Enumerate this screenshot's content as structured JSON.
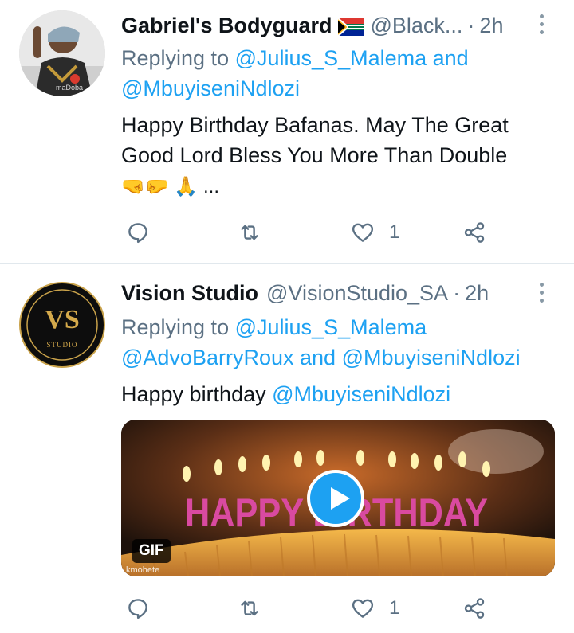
{
  "tweets": [
    {
      "name": "Gabriel's Bodyguard",
      "handle": "@Black...",
      "dot": "·",
      "time": "2h",
      "reply_prefix": "Replying to",
      "reply_line1_mention": "@Julius_S_Malema",
      "reply_line1_suffix": "and",
      "reply_line2": "@MbuyiseniNdlozi",
      "text_line1": "Happy Birthday Bafanas. May The Great",
      "text_line2": "Good Lord Bless You More Than Double",
      "text_line3_emoji": "🤜🤛 🙏 ...",
      "reply_count": "",
      "retweet_count": "",
      "like_count": "1"
    },
    {
      "name": "Vision Studio",
      "handle": "@VisionStudio_SA",
      "dot": "·",
      "time": "2h",
      "avatar_text": "VS",
      "avatar_subtext": "STUDIO",
      "reply_prefix": "Replying to",
      "reply_line1_mention": "@Julius_S_Malema",
      "reply_line2_mention_a": "@AdvoBarryRoux",
      "reply_line2_and": "and",
      "reply_line2_mention_b": "@MbuyiseniNdlozi",
      "text_prefix": "Happy birthday",
      "text_mention": "@MbuyiseniNdlozi",
      "media_badge": "GIF",
      "media_caption": "HAPPY BIRTHDAY",
      "media_watermark": "kmohete",
      "like_count": "1"
    }
  ],
  "colors": {
    "link": "#1da1f2",
    "secondary": "#5b7083",
    "divider": "#e1e8ed"
  }
}
